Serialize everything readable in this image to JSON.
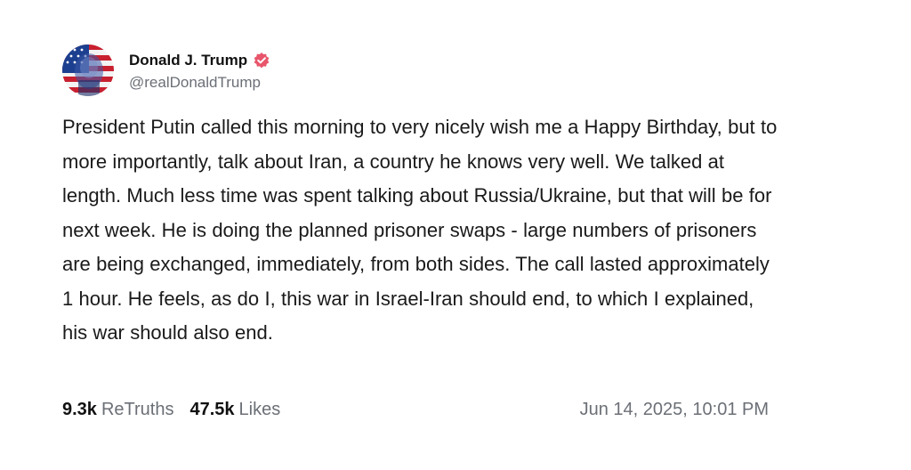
{
  "author": {
    "display_name": "Donald J. Trump",
    "handle": "@realDonaldTrump",
    "verified": true,
    "avatar_icon": "profile-avatar-flag",
    "verified_icon": "verified-badge-icon",
    "verified_color": "#e8566b"
  },
  "post": {
    "text": "President Putin called this morning to very nicely wish me a Happy Birthday, but to more importantly, talk about Iran, a country he knows very well. We talked at length. Much less time was spent talking about Russia/Ukraine, but that will be for next week. He is doing the planned prisoner swaps - large numbers of prisoners are being exchanged, immediately, from both sides. The call lasted approximately 1 hour. He feels, as do I, this war in Israel-Iran should end, to which I explained, his war should also end."
  },
  "stats": {
    "retruths_count": "9.3k",
    "retruths_label": "ReTruths",
    "likes_count": "47.5k",
    "likes_label": "Likes",
    "timestamp": "Jun 14, 2025, 10:01 PM"
  },
  "colors": {
    "text_primary": "#111111",
    "text_secondary": "#6b6f76",
    "background": "#ffffff"
  }
}
